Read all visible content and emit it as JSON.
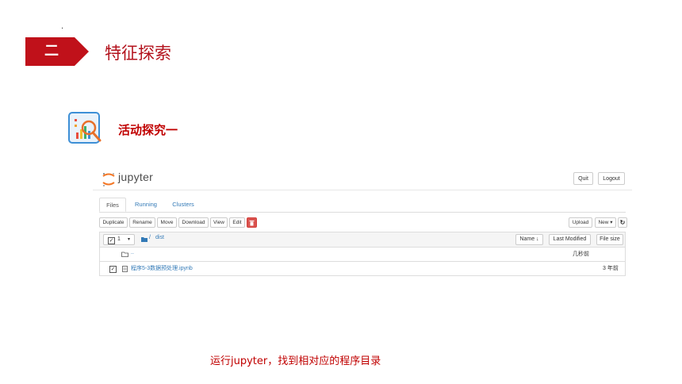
{
  "slide": {
    "dot": ".",
    "section_number": "二",
    "section_title": "特征探索",
    "activity_title": "活动探究一",
    "caption": "运行jupyter，找到相对应的程序目录"
  },
  "jupyter": {
    "logo_text": "jupyter",
    "quit_label": "Quit",
    "logout_label": "Logout",
    "tabs": [
      {
        "label": "Files"
      },
      {
        "label": "Running"
      },
      {
        "label": "Clusters"
      }
    ],
    "toolbar": {
      "duplicate": "Duplicate",
      "rename": "Rename",
      "move": "Move",
      "download": "Download",
      "view": "View",
      "edit": "Edit",
      "upload": "Upload",
      "new": "New ▾",
      "refresh_icon": "↻"
    },
    "list_header": {
      "selected_count": "1",
      "path_sep": "/",
      "folder": "dist",
      "name_sort": "Name ↓",
      "last_modified": "Last Modified",
      "file_size": "File size"
    },
    "rows": [
      {
        "name": "..",
        "modified": "几秒前"
      },
      {
        "name": "程序5-3数据预处理.ipynb",
        "modified": "3 年前"
      }
    ]
  },
  "colors": {
    "section_red": "#c0111a",
    "title_red": "#b3121c",
    "link_blue": "#337ab7"
  }
}
